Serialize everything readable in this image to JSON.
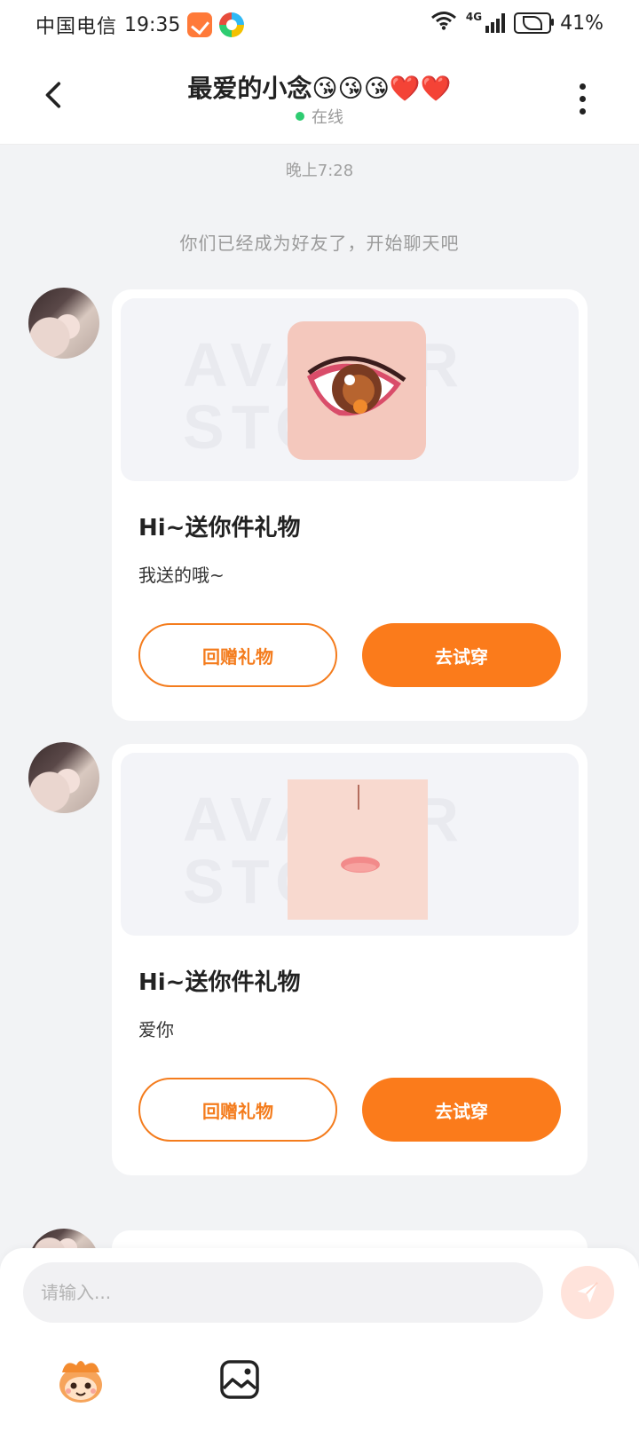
{
  "status_bar": {
    "carrier": "中国电信",
    "time": "19:35",
    "network": "4G",
    "battery": "41%"
  },
  "header": {
    "title": "最爱的小念😘😘😘❤️❤️",
    "status": "在线"
  },
  "chat": {
    "timestamp": "晚上7:28",
    "system_message": "你们已经成为好友了，开始聊天吧",
    "gifts": [
      {
        "watermark": "AVATAR STORE",
        "title": "Hi~送你件礼物",
        "message": "我送的哦~",
        "return_label": "回赠礼物",
        "try_label": "去试穿"
      },
      {
        "watermark": "AVATAR STORE",
        "title": "Hi~送你件礼物",
        "message": "爱你",
        "return_label": "回赠礼物",
        "try_label": "去试穿"
      }
    ]
  },
  "input": {
    "placeholder": "请输入..."
  },
  "colors": {
    "accent": "#fb7b1b",
    "background": "#f2f3f5",
    "online": "#2ecc71"
  },
  "icons": {
    "back": "chevron-left-icon",
    "more": "more-vertical-icon",
    "send": "send-icon",
    "mascot": "mascot-icon",
    "image": "image-icon"
  }
}
